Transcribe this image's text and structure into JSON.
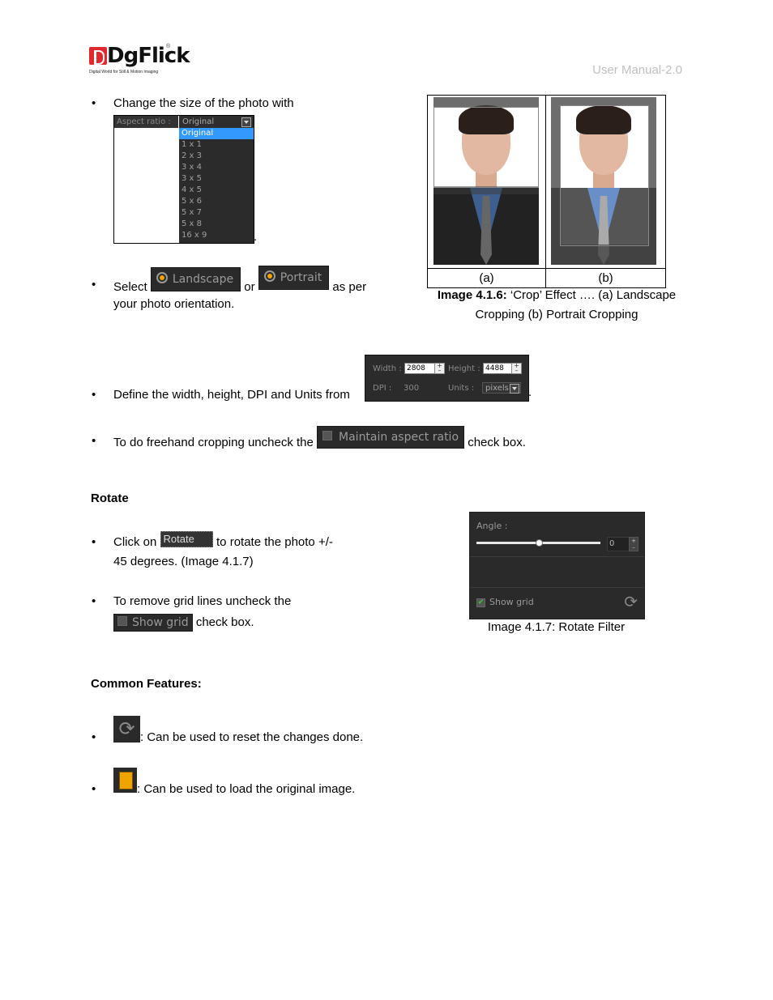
{
  "header": {
    "logo_text": "DgFlick",
    "logo_tagline": "Digital World for Still & Motion Imaging",
    "logo_registered": "®",
    "right_text": "User Manual-2.0"
  },
  "bullets": {
    "change_size": "Change the size of the photo with",
    "change_size_end": ".",
    "select_prefix": "Select",
    "select_or": "or",
    "select_suffix": "as per",
    "select_line2": "your photo orientation.",
    "define_dims": "Define the width, height, DPI and Units from",
    "define_dims_end": ".",
    "freehand_prefix": "To do freehand cropping uncheck the",
    "freehand_suffix": "check box."
  },
  "aspect_widget": {
    "label": "Aspect ratio :",
    "selected": "Original",
    "options": [
      "Original",
      "1 x 1",
      "2 x 3",
      "3 x 4",
      "3 x 5",
      "4 x 5",
      "5 x 6",
      "5 x 7",
      "5 x 8",
      "16 x 9"
    ],
    "active_index": 0
  },
  "orientation": {
    "landscape_label": "Landscape",
    "portrait_label": "Portrait"
  },
  "dims_widget": {
    "width_label": "Width :",
    "width_value": "2808",
    "height_label": "Height :",
    "height_value": "4488",
    "dpi_label": "DPI :",
    "dpi_value": "300",
    "units_label": "Units :",
    "units_value": "pixels",
    "plus": "+",
    "minus": "–"
  },
  "maintain_aspect": {
    "label": "Maintain aspect ratio",
    "checked": false
  },
  "figure_416": {
    "label_a": "(a)",
    "label_b": "(b)",
    "caption_bold": "Image 4.1.6:",
    "caption_rest": " ‘Crop’ Effect …. (a) Landscape",
    "caption_line2": "Cropping (b) Portrait Cropping"
  },
  "rotate_section": {
    "heading": "Rotate",
    "click_on": "Click on",
    "rotate_btn": "Rotate",
    "click_suffix": "to rotate the photo +/-",
    "line2": "45 degrees.  (Image 4.1.7)",
    "grid_prefix": "To remove grid lines uncheck the",
    "show_grid_btn": "Show grid",
    "grid_suffix": "check box."
  },
  "rotate_panel": {
    "angle_label": "Angle :",
    "angle_value": "0",
    "slider_fraction": 0.5,
    "show_grid_label": "Show grid",
    "show_grid_checked": true,
    "check_glyph": "✔",
    "reset_icon": "⟳",
    "caption": "Image 4.1.7: Rotate Filter"
  },
  "common": {
    "heading": "Common Features:",
    "reset_text": ": Can be used to reset the changes done.",
    "load_text": ": Can be used to load the original image."
  },
  "bullet_glyph": "•"
}
